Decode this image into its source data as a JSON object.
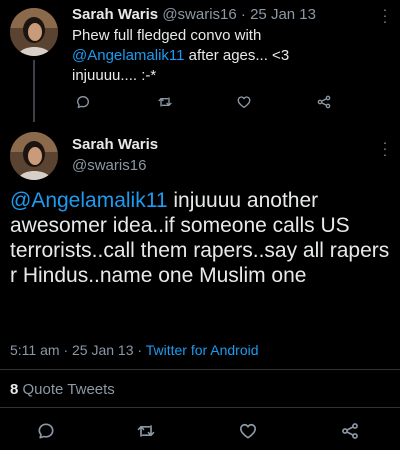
{
  "parent_tweet": {
    "name": "Sarah Waris",
    "handle": "@swaris16",
    "separator": "·",
    "date": "25 Jan 13",
    "text_line1": "Phew full fledged convo with",
    "mention": "@Angelamalik11",
    "text_line2_rest": " after ages... <3",
    "text_line3": "injuuuu.... :-*",
    "actions": [
      "reply-icon",
      "retweet-icon",
      "like-icon",
      "share-icon"
    ]
  },
  "main_tweet": {
    "name": "Sarah Waris",
    "handle": "@swaris16",
    "mention": "@Angelamalik11",
    "text_rest": " injuuuu another awesomer idea..if someone calls US terrorists..call them rapers..say all rapers r Hindus..name one Muslim one",
    "time": "5:11 am",
    "separator": "·",
    "date": "25 Jan 13",
    "source_separator": "·",
    "source": "Twitter for Android",
    "quote_count": "8",
    "quote_label": "Quote Tweets",
    "actions": [
      "reply-icon",
      "retweet-icon",
      "like-icon",
      "share-icon"
    ]
  },
  "colors": {
    "background": "#000000",
    "text": "#e7e9ea",
    "secondary": "#8b98a5",
    "link": "#1d9bf0",
    "divider": "#2f3336"
  }
}
